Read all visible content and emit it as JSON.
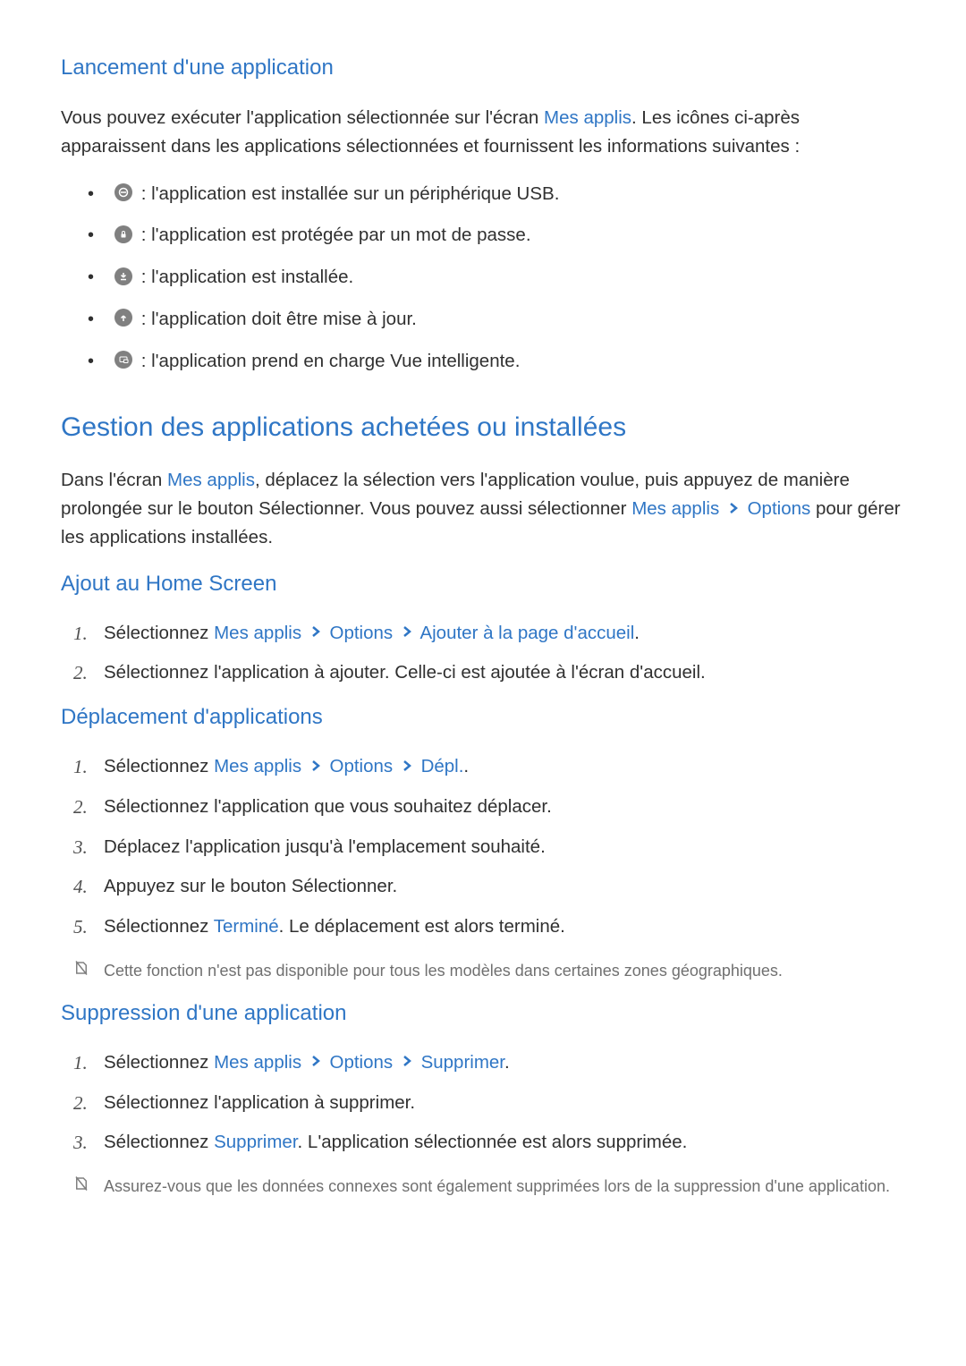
{
  "section1": {
    "title": "Lancement d'une application",
    "intro_pre": "Vous pouvez exécuter l'application sélectionnée sur l'écran ",
    "intro_link": "Mes applis",
    "intro_post": ". Les icônes ci-après apparaissent dans les applications sélectionnées et fournissent les informations suivantes :",
    "items": {
      "usb": " : l'application est installée sur un périphérique USB.",
      "lock": " : l'application est protégée par un mot de passe.",
      "down": " : l'application est installée.",
      "up": " : l'application doit être mise à jour.",
      "smart": " : l'application prend en charge Vue intelligente."
    }
  },
  "heading2": "Gestion des applications achetées ou installées",
  "manage": {
    "pre": "Dans l'écran ",
    "l1": "Mes applis",
    "mid1": ", déplacez la sélection vers l'application voulue, puis appuyez de manière prolongée sur le bouton Sélectionner. Vous pouvez aussi sélectionner ",
    "l2": "Mes applis",
    "l3": "Options",
    "post": " pour gérer les applications installées."
  },
  "addhome": {
    "title": "Ajout au Home Screen",
    "s1": {
      "pre": "Sélectionnez ",
      "l1": "Mes applis",
      "l2": "Options",
      "l3": "Ajouter à la page d'accueil",
      "post": "."
    },
    "s2": "Sélectionnez l'application à ajouter. Celle-ci est ajoutée à l'écran d'accueil."
  },
  "move": {
    "title": "Déplacement d'applications",
    "s1": {
      "pre": "Sélectionnez ",
      "l1": "Mes applis",
      "l2": "Options",
      "l3": "Dépl.",
      "post": "."
    },
    "s2": "Sélectionnez l'application que vous souhaitez déplacer.",
    "s3": "Déplacez l'application jusqu'à l'emplacement souhaité.",
    "s4": "Appuyez sur le bouton Sélectionner.",
    "s5": {
      "pre": "Sélectionnez ",
      "l1": "Terminé",
      "post": ". Le déplacement est alors terminé."
    },
    "note": "Cette fonction n'est pas disponible pour tous les modèles dans certaines zones géographiques."
  },
  "delete": {
    "title": "Suppression d'une application",
    "s1": {
      "pre": "Sélectionnez ",
      "l1": "Mes applis",
      "l2": "Options",
      "l3": "Supprimer",
      "post": "."
    },
    "s2": "Sélectionnez l'application à supprimer.",
    "s3": {
      "pre": "Sélectionnez ",
      "l1": "Supprimer",
      "post": ". L'application sélectionnée est alors supprimée."
    },
    "note": "Assurez-vous que les données connexes sont également supprimées lors de la suppression d'une application."
  }
}
